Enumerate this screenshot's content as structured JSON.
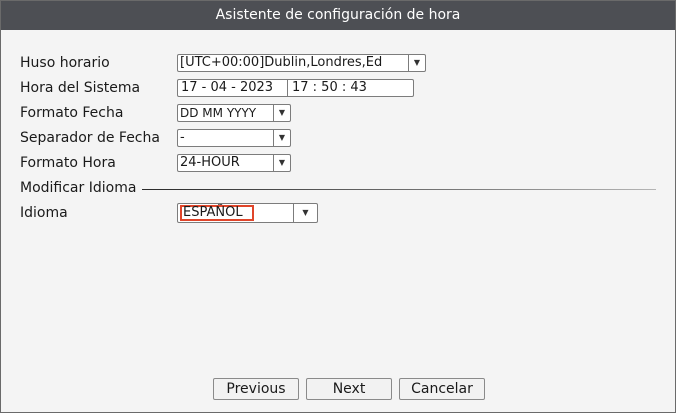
{
  "window": {
    "title": "Asistente de configuración de hora"
  },
  "timezone": {
    "label": "Huso horario",
    "value": "[UTC+00:00]Dublin,Londres,Ed"
  },
  "system_time": {
    "label": "Hora del Sistema",
    "date": "17 - 04 - 2023",
    "time": "17 : 50 : 43"
  },
  "date_format": {
    "label": "Formato Fecha",
    "value": "DD MM YYYY"
  },
  "date_separator": {
    "label": "Separador de Fecha",
    "value": "-"
  },
  "time_format": {
    "label": "Formato Hora",
    "value": "24-HOUR"
  },
  "language_section": {
    "title": "Modificar Idioma"
  },
  "language": {
    "label": "Idioma",
    "value": "ESPAÑOL"
  },
  "buttons": {
    "previous": "Previous",
    "next": "Next",
    "cancel": "Cancelar"
  },
  "colors": {
    "titlebar": "#4d4f54",
    "focus_border": "#e0452a",
    "background": "#f4f4f4"
  }
}
